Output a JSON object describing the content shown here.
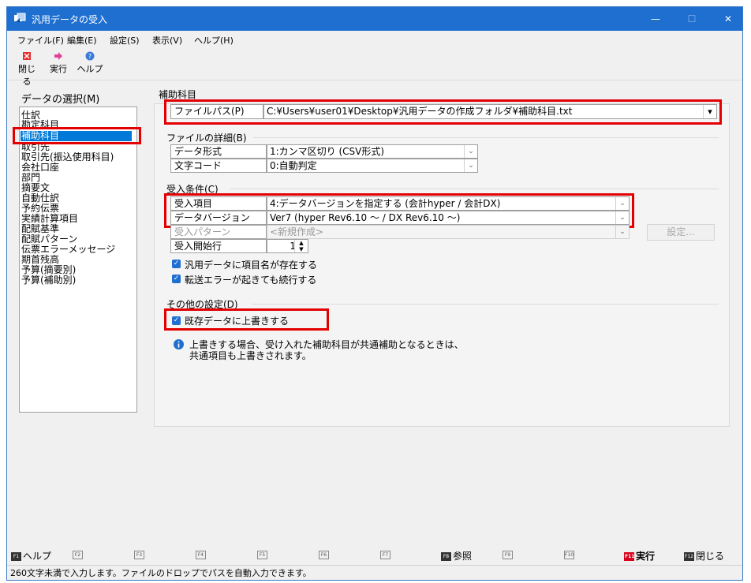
{
  "window": {
    "title": "汎用データの受入",
    "min": "—",
    "max": "☐",
    "close": "✕"
  },
  "menu": [
    "ファイル(F)",
    "編集(E)",
    "設定(S)",
    "表示(V)",
    "ヘルプ(H)"
  ],
  "toolbar": {
    "close": "閉じる",
    "run": "実行",
    "help": "ヘルプ"
  },
  "left": {
    "title": "データの選択(M)",
    "items": [
      "仕訳",
      "勘定科目",
      "補助科目",
      "取引先",
      "取引先(振込使用科目)",
      "会社口座",
      "部門",
      "摘要文",
      "自動仕訳",
      "予約伝票",
      "実績計算項目",
      "配賦基準",
      "配賦パターン",
      "伝票エラーメッセージ",
      "期首残高",
      "予算(摘要別)",
      "予算(補助別)"
    ],
    "selected_index": 2
  },
  "section_main": {
    "title": "補助科目",
    "file_path_label": "ファイルパス(P)",
    "file_path_value": "C:¥Users¥user01¥Desktop¥汎用データの作成フォルダ¥補助科目.txt"
  },
  "file_details": {
    "title": "ファイルの詳細(B)",
    "format_label": "データ形式",
    "format_value": "1:カンマ区切り (CSV形式)",
    "encoding_label": "文字コード",
    "encoding_value": "0:自動判定"
  },
  "receive": {
    "title": "受入条件(C)",
    "item_label": "受入項目",
    "item_value": "4:データバージョンを指定する (会計hyper / 会計DX)",
    "version_label": "データバージョン",
    "version_value": "Ver7  (hyper Rev6.10 ～ / DX Rev6.10 ～)",
    "pattern_label": "受入パターン",
    "pattern_value": "<新規作成>",
    "settings_button": "設定...",
    "start_row_label": "受入開始行",
    "start_row_value": "1",
    "chk1": "汎用データに項目名が存在する",
    "chk1_checked": true,
    "chk2": "転送エラーが起きても続行する",
    "chk2_checked": true
  },
  "other": {
    "title": "その他の設定(D)",
    "chk_overwrite": "既存データに上書きする",
    "chk_overwrite_checked": true,
    "info_line1": "上書きする場合、受け入れた補助科目が共通補助となるときは、",
    "info_line2": "共通項目も上書きされます。"
  },
  "fkeys": {
    "f1": "ヘルプ",
    "f2": "",
    "f3": "",
    "f4": "",
    "f5": "",
    "f6": "",
    "f7": "",
    "f8": "参照",
    "f9": "",
    "f10": "",
    "f11": "実行",
    "f12": "閉じる",
    "badges": [
      "F1",
      "F2",
      "F3",
      "F4",
      "F5",
      "F6",
      "F7",
      "F8",
      "F9",
      "F10",
      "F11",
      "F12"
    ]
  },
  "status": "260文字未満で入力します。ファイルのドロップでパスを自動入力できます。",
  "colors": {
    "titlebar": "#1e6fd0",
    "accent": "#0078d7",
    "highlight": "#e30000"
  }
}
